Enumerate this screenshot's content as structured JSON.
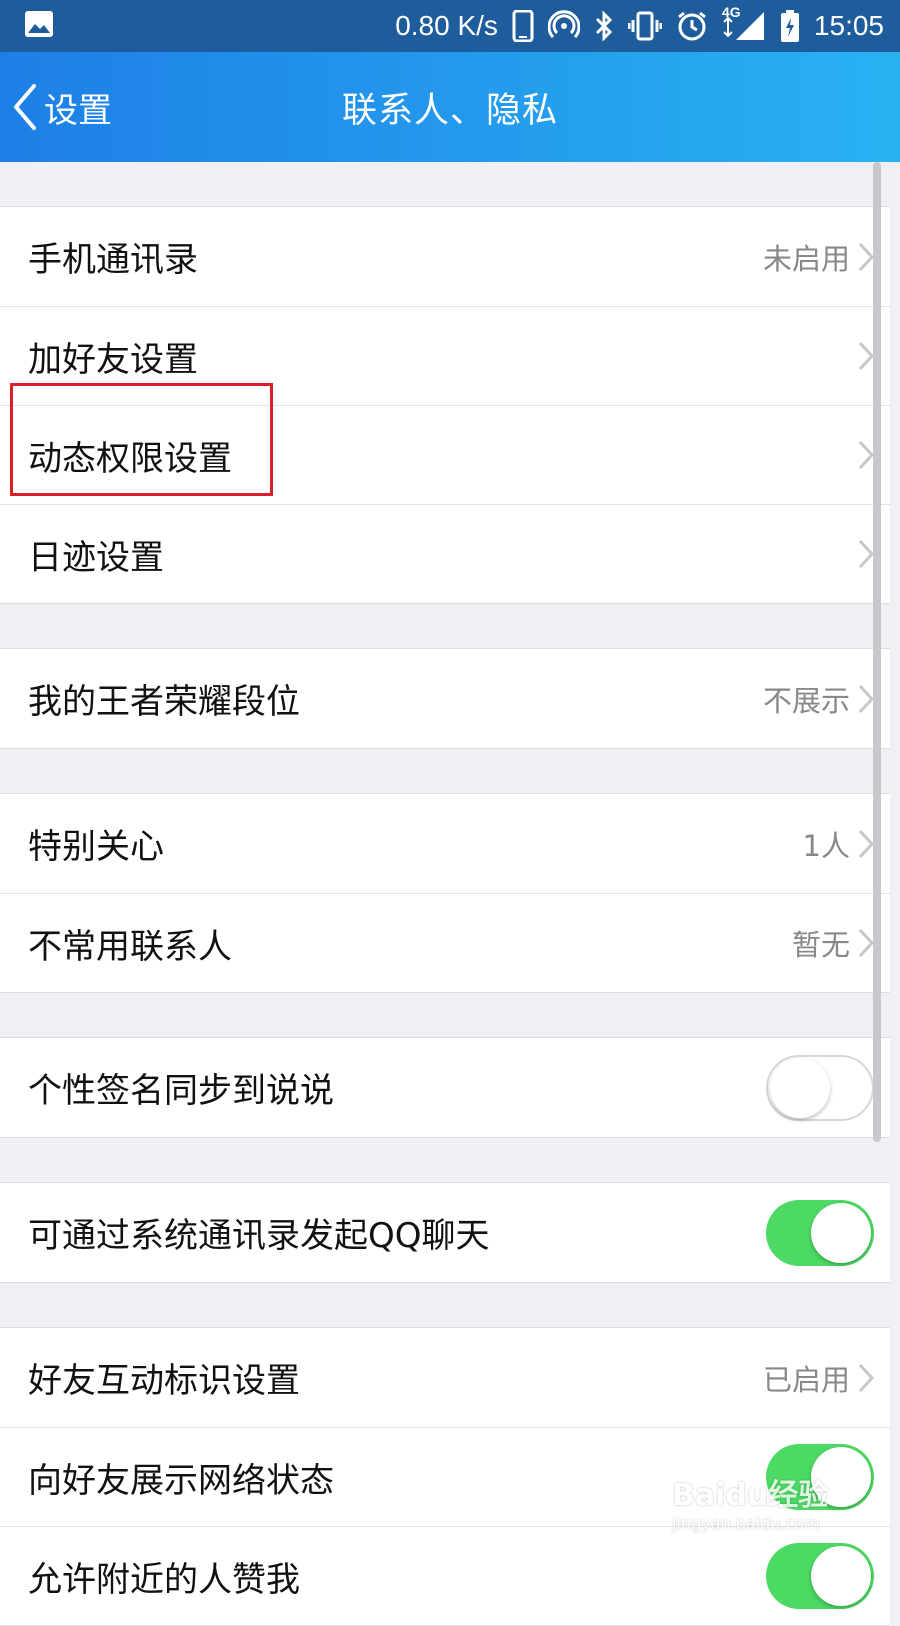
{
  "status_bar": {
    "net_speed": "0.80 K/s",
    "network_type": "4G",
    "time": "15:05",
    "icons": [
      "image-icon",
      "phone-icon",
      "hotspot-icon",
      "bluetooth-icon",
      "vibrate-icon",
      "alarm-icon",
      "signal-icon",
      "battery-icon"
    ]
  },
  "nav": {
    "back_label": "设置",
    "title": "联系人、隐私"
  },
  "groups": [
    {
      "rows": [
        {
          "label": "手机通讯录",
          "value": "未启用",
          "type": "link"
        },
        {
          "label": "加好友设置",
          "value": "",
          "type": "link"
        },
        {
          "label": "动态权限设置",
          "value": "",
          "type": "link"
        },
        {
          "label": "日迹设置",
          "value": "",
          "type": "link"
        }
      ]
    },
    {
      "rows": [
        {
          "label": "我的王者荣耀段位",
          "value": "不展示",
          "type": "link"
        }
      ]
    },
    {
      "rows": [
        {
          "label": "特别关心",
          "value": "1人",
          "type": "link"
        },
        {
          "label": "不常用联系人",
          "value": "暂无",
          "type": "link"
        }
      ]
    },
    {
      "rows": [
        {
          "label": "个性签名同步到说说",
          "type": "toggle",
          "on": false
        }
      ]
    },
    {
      "rows": [
        {
          "label": "可通过系统通讯录发起QQ聊天",
          "type": "toggle",
          "on": true
        }
      ]
    },
    {
      "rows": [
        {
          "label": "好友互动标识设置",
          "value": "已启用",
          "type": "link"
        },
        {
          "label": "向好友展示网络状态",
          "type": "toggle",
          "on": true
        },
        {
          "label": "允许附近的人赞我",
          "type": "toggle",
          "on": true
        }
      ]
    }
  ],
  "watermark": {
    "logo": "Baidu经验",
    "url": "jingyan.baidu.com"
  },
  "colors": {
    "toggle_on": "#4cd964",
    "nav_start": "#1d7fe6",
    "nav_end": "#29b2f2",
    "highlight": "#d9202a"
  }
}
